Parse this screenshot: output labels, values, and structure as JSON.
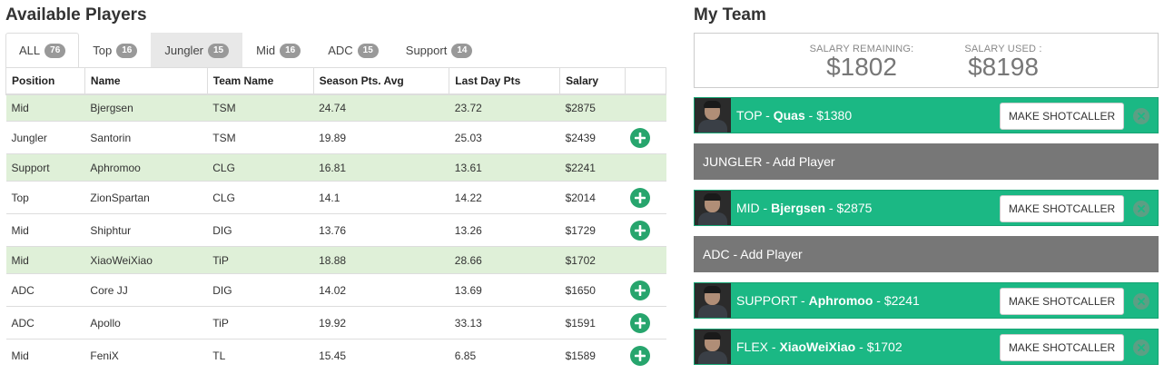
{
  "available": {
    "title": "Available Players",
    "tabs": [
      {
        "label": "ALL",
        "count": "76"
      },
      {
        "label": "Top",
        "count": "16"
      },
      {
        "label": "Jungler",
        "count": "15"
      },
      {
        "label": "Mid",
        "count": "16"
      },
      {
        "label": "ADC",
        "count": "15"
      },
      {
        "label": "Support",
        "count": "14"
      }
    ],
    "columns": [
      "Position",
      "Name",
      "Team Name",
      "Season Pts. Avg",
      "Last Day Pts",
      "Salary"
    ],
    "rows": [
      {
        "position": "Mid",
        "name": "Bjergsen",
        "team": "TSM",
        "season": "24.74",
        "lastday": "23.72",
        "salary": "$2875",
        "highlighted": true
      },
      {
        "position": "Jungler",
        "name": "Santorin",
        "team": "TSM",
        "season": "19.89",
        "lastday": "25.03",
        "salary": "$2439",
        "highlighted": false
      },
      {
        "position": "Support",
        "name": "Aphromoo",
        "team": "CLG",
        "season": "16.81",
        "lastday": "13.61",
        "salary": "$2241",
        "highlighted": true
      },
      {
        "position": "Top",
        "name": "ZionSpartan",
        "team": "CLG",
        "season": "14.1",
        "lastday": "14.22",
        "salary": "$2014",
        "highlighted": false
      },
      {
        "position": "Mid",
        "name": "Shiphtur",
        "team": "DIG",
        "season": "13.76",
        "lastday": "13.26",
        "salary": "$1729",
        "highlighted": false
      },
      {
        "position": "Mid",
        "name": "XiaoWeiXiao",
        "team": "TiP",
        "season": "18.88",
        "lastday": "28.66",
        "salary": "$1702",
        "highlighted": true
      },
      {
        "position": "ADC",
        "name": "Core JJ",
        "team": "DIG",
        "season": "14.02",
        "lastday": "13.69",
        "salary": "$1650",
        "highlighted": false
      },
      {
        "position": "ADC",
        "name": "Apollo",
        "team": "TiP",
        "season": "19.92",
        "lastday": "33.13",
        "salary": "$1591",
        "highlighted": false
      },
      {
        "position": "Mid",
        "name": "FeniX",
        "team": "TL",
        "season": "15.45",
        "lastday": "6.85",
        "salary": "$1589",
        "highlighted": false
      }
    ]
  },
  "team": {
    "title": "My Team",
    "salary_remaining_label": "SALARY REMAINING:",
    "salary_remaining": "$1802",
    "salary_used_label": "SALARY USED :",
    "salary_used": "$8198",
    "shotcaller_label": "MAKE SHOTCALLER",
    "slots": [
      {
        "role": "TOP",
        "player": "Quas",
        "salary": "$1380",
        "filled": true
      },
      {
        "role": "JUNGLER",
        "action": "Add Player",
        "filled": false
      },
      {
        "role": "MID",
        "player": "Bjergsen",
        "salary": "$2875",
        "filled": true
      },
      {
        "role": "ADC",
        "action": "Add Player",
        "filled": false
      },
      {
        "role": "SUPPORT",
        "player": "Aphromoo",
        "salary": "$2241",
        "filled": true
      },
      {
        "role": "FLEX",
        "player": "XiaoWeiXiao",
        "salary": "$1702",
        "filled": true
      }
    ]
  },
  "colors": {
    "accent_green": "#1bb884",
    "row_highlight": "#dff0d8",
    "empty_slot": "#777777",
    "add_button": "#27a56d"
  },
  "icons": {
    "add": "plus-circle-icon",
    "remove": "close-circle-icon",
    "avatar": "player-photo"
  }
}
